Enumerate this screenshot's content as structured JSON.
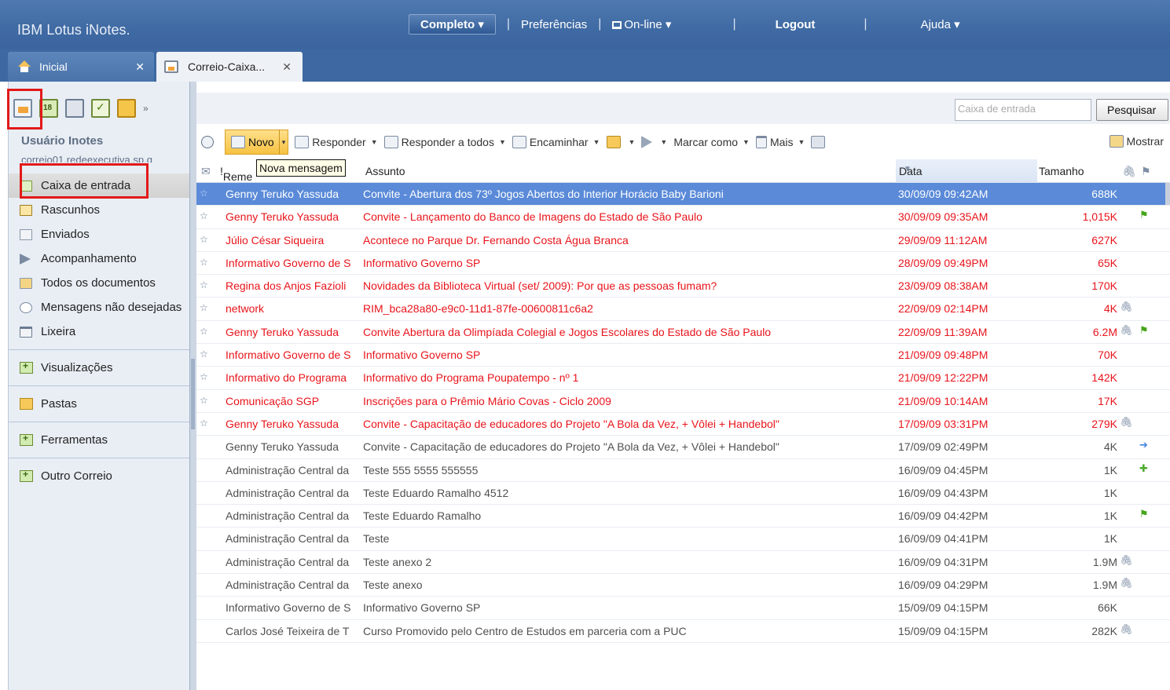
{
  "app": {
    "brand": "IBM Lotus iNotes."
  },
  "topnav": {
    "full_label": "Completo ▾",
    "preferences": "Preferências",
    "online": "On-line ▾",
    "logout": "Logout",
    "help": "Ajuda ▾"
  },
  "tabs": {
    "home": "Inicial",
    "mail": "Correio-Caixa...",
    "close": "✕"
  },
  "sidebar": {
    "more": "»",
    "user_name": "Usuário Inotes",
    "user_email": "correio01.redeexecutiva.sp.g",
    "items": [
      {
        "label": "Caixa de entrada",
        "icon": "inbox-icon"
      },
      {
        "label": "Rascunhos",
        "icon": "drafts-icon"
      },
      {
        "label": "Enviados",
        "icon": "sent-icon"
      },
      {
        "label": "Acompanhamento",
        "icon": "flag-icon"
      },
      {
        "label": "Todos os documentos",
        "icon": "documents-icon"
      },
      {
        "label": "Mensagens não desejadas",
        "icon": "junk-icon"
      },
      {
        "label": "Lixeira",
        "icon": "trash-icon"
      }
    ],
    "sections": {
      "views": "Visualizações",
      "folders": "Pastas",
      "tools": "Ferramentas",
      "other_mail": "Outro Correio"
    }
  },
  "search": {
    "placeholder": "Caixa de entrada",
    "button": "Pesquisar"
  },
  "toolbar": {
    "new": "Novo",
    "reply": "Responder",
    "reply_all": "Responder a todos",
    "forward": "Encaminhar",
    "mark_as": "Marcar como",
    "more": "Mais",
    "show": "Mostrar",
    "tooltip": "Nova mensagem"
  },
  "columns": {
    "from": "Reme",
    "subject": "Assunto",
    "date": "Data",
    "size": "Tamanho"
  },
  "messages": [
    {
      "star": true,
      "from": "Genny Teruko Yassuda",
      "subject": "Convite - Abertura dos 73º Jogos Abertos do Interior Horácio Baby Barioni",
      "date": "30/09/09 09:42AM",
      "size": "688K",
      "attach": false,
      "mark": "",
      "state": "selected"
    },
    {
      "star": true,
      "from": "Genny Teruko Yassuda",
      "subject": "Convite - Lançamento do Banco de Imagens do Estado de São Paulo",
      "date": "30/09/09 09:35AM",
      "size": "1,015K",
      "attach": false,
      "mark": "flag",
      "state": "unread"
    },
    {
      "star": true,
      "from": "Júlio César Siqueira",
      "subject": "Acontece no Parque Dr. Fernando Costa Água Branca",
      "date": "29/09/09 11:12AM",
      "size": "627K",
      "attach": false,
      "mark": "",
      "state": "unread"
    },
    {
      "star": true,
      "from": "Informativo Governo de S",
      "subject": "Informativo Governo SP",
      "date": "28/09/09 09:49PM",
      "size": "65K",
      "attach": false,
      "mark": "",
      "state": "unread"
    },
    {
      "star": true,
      "from": "Regina dos Anjos Fazioli",
      "subject": "Novidades da Biblioteca Virtual (set/ 2009): Por que as pessoas fumam?",
      "date": "23/09/09 08:38AM",
      "size": "170K",
      "attach": false,
      "mark": "",
      "state": "unread"
    },
    {
      "star": true,
      "from": "network",
      "subject": "RIM_bca28a80-e9c0-11d1-87fe-00600811c6a2",
      "date": "22/09/09 02:14PM",
      "size": "4K",
      "attach": true,
      "mark": "",
      "state": "unread"
    },
    {
      "star": true,
      "from": "Genny Teruko Yassuda",
      "subject": "Convite Abertura da Olimpíada Colegial e Jogos Escolares do Estado de São Paulo",
      "date": "22/09/09 11:39AM",
      "size": "6.2M",
      "attach": true,
      "mark": "flag",
      "state": "unread"
    },
    {
      "star": true,
      "from": "Informativo Governo de S",
      "subject": "Informativo Governo SP",
      "date": "21/09/09 09:48PM",
      "size": "70K",
      "attach": false,
      "mark": "",
      "state": "unread"
    },
    {
      "star": true,
      "from": "Informativo do Programa",
      "subject": "Informativo do Programa Poupatempo - nº 1",
      "date": "21/09/09 12:22PM",
      "size": "142K",
      "attach": false,
      "mark": "",
      "state": "unread"
    },
    {
      "star": true,
      "from": "Comunicação SGP",
      "subject": "Inscrições para o Prêmio Mário Covas - Ciclo 2009",
      "date": "21/09/09 10:14AM",
      "size": "17K",
      "attach": false,
      "mark": "",
      "state": "unread"
    },
    {
      "star": true,
      "from": "Genny Teruko Yassuda",
      "subject": "Convite - Capacitação de educadores do Projeto \"A Bola da Vez, + Vôlei + Handebol\"",
      "date": "17/09/09 03:31PM",
      "size": "279K",
      "attach": true,
      "mark": "",
      "state": "unread"
    },
    {
      "star": false,
      "from": "Genny Teruko Yassuda",
      "subject": "Convite - Capacitação de educadores do Projeto \"A Bola da Vez, + Vôlei + Handebol\"",
      "date": "17/09/09 02:49PM",
      "size": "4K",
      "attach": false,
      "mark": "fwd",
      "state": "read"
    },
    {
      "star": false,
      "from": "Administração Central da",
      "subject": "Teste 555 5555 555555",
      "date": "16/09/09 04:45PM",
      "size": "1K",
      "attach": false,
      "mark": "reply",
      "state": "read"
    },
    {
      "star": false,
      "from": "Administração Central da",
      "subject": "Teste Eduardo Ramalho 4512",
      "date": "16/09/09 04:43PM",
      "size": "1K",
      "attach": false,
      "mark": "",
      "state": "read"
    },
    {
      "star": false,
      "from": "Administração Central da",
      "subject": "Teste Eduardo Ramalho",
      "date": "16/09/09 04:42PM",
      "size": "1K",
      "attach": false,
      "mark": "flag",
      "state": "read"
    },
    {
      "star": false,
      "from": "Administração Central da",
      "subject": "Teste",
      "date": "16/09/09 04:41PM",
      "size": "1K",
      "attach": false,
      "mark": "",
      "state": "read"
    },
    {
      "star": false,
      "from": "Administração Central da",
      "subject": "Teste anexo 2",
      "date": "16/09/09 04:31PM",
      "size": "1.9M",
      "attach": true,
      "mark": "",
      "state": "read"
    },
    {
      "star": false,
      "from": "Administração Central da",
      "subject": "Teste anexo",
      "date": "16/09/09 04:29PM",
      "size": "1.9M",
      "attach": true,
      "mark": "",
      "state": "read"
    },
    {
      "star": false,
      "from": "Informativo Governo de S",
      "subject": "Informativo Governo SP",
      "date": "15/09/09 04:15PM",
      "size": "66K",
      "attach": false,
      "mark": "",
      "state": "read"
    },
    {
      "star": false,
      "from": "Carlos José Teixeira de T",
      "subject": "Curso Promovido pelo Centro de Estudos em parceria com a PUC",
      "date": "15/09/09 04:15PM",
      "size": "282K",
      "attach": true,
      "mark": "",
      "state": "read"
    }
  ],
  "colors": {
    "header_blue": "#3f6aa3",
    "unread_red": "#e8141b",
    "selected_blue": "#5a8ad8",
    "highlight_red": "#e21919"
  }
}
